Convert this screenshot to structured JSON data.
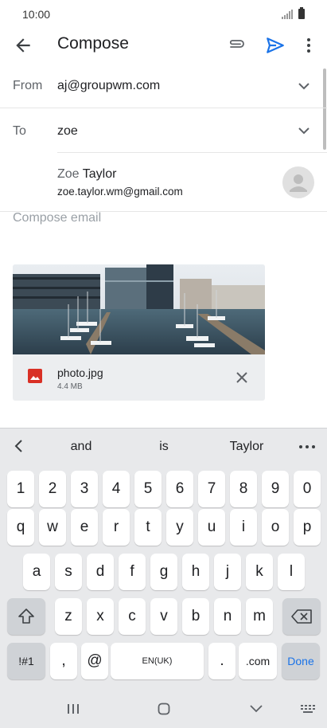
{
  "status": {
    "time": "10:00"
  },
  "appbar": {
    "title": "Compose"
  },
  "from": {
    "label": "From",
    "value": "aj@groupwm.com"
  },
  "to": {
    "label": "To",
    "value": "zoe"
  },
  "suggestion": {
    "name_match": "Zoe",
    "name_rest": " Taylor",
    "email": "zoe.taylor.wm@gmail.com"
  },
  "body": {
    "placeholder": "Compose email"
  },
  "attachment": {
    "filename": "photo.jpg",
    "size": "4.4 MB"
  },
  "keyboard": {
    "suggestions": [
      "and",
      "is",
      "Taylor"
    ],
    "numbers": [
      "1",
      "2",
      "3",
      "4",
      "5",
      "6",
      "7",
      "8",
      "9",
      "0"
    ],
    "row1": [
      "q",
      "w",
      "e",
      "r",
      "t",
      "y",
      "u",
      "i",
      "o",
      "p"
    ],
    "row2": [
      "a",
      "s",
      "d",
      "f",
      "g",
      "h",
      "j",
      "k",
      "l"
    ],
    "row3": [
      "z",
      "x",
      "c",
      "v",
      "b",
      "n",
      "m"
    ],
    "symbols_label": "!#1",
    "comma": ",",
    "at": "@",
    "space_label": "EN(UK)",
    "period": ".",
    "dotcom": ".com",
    "done": "Done"
  },
  "colors": {
    "accent": "#1a73e8",
    "keyboard_bg": "#e8e9eb",
    "image_icon": "#d93025"
  }
}
